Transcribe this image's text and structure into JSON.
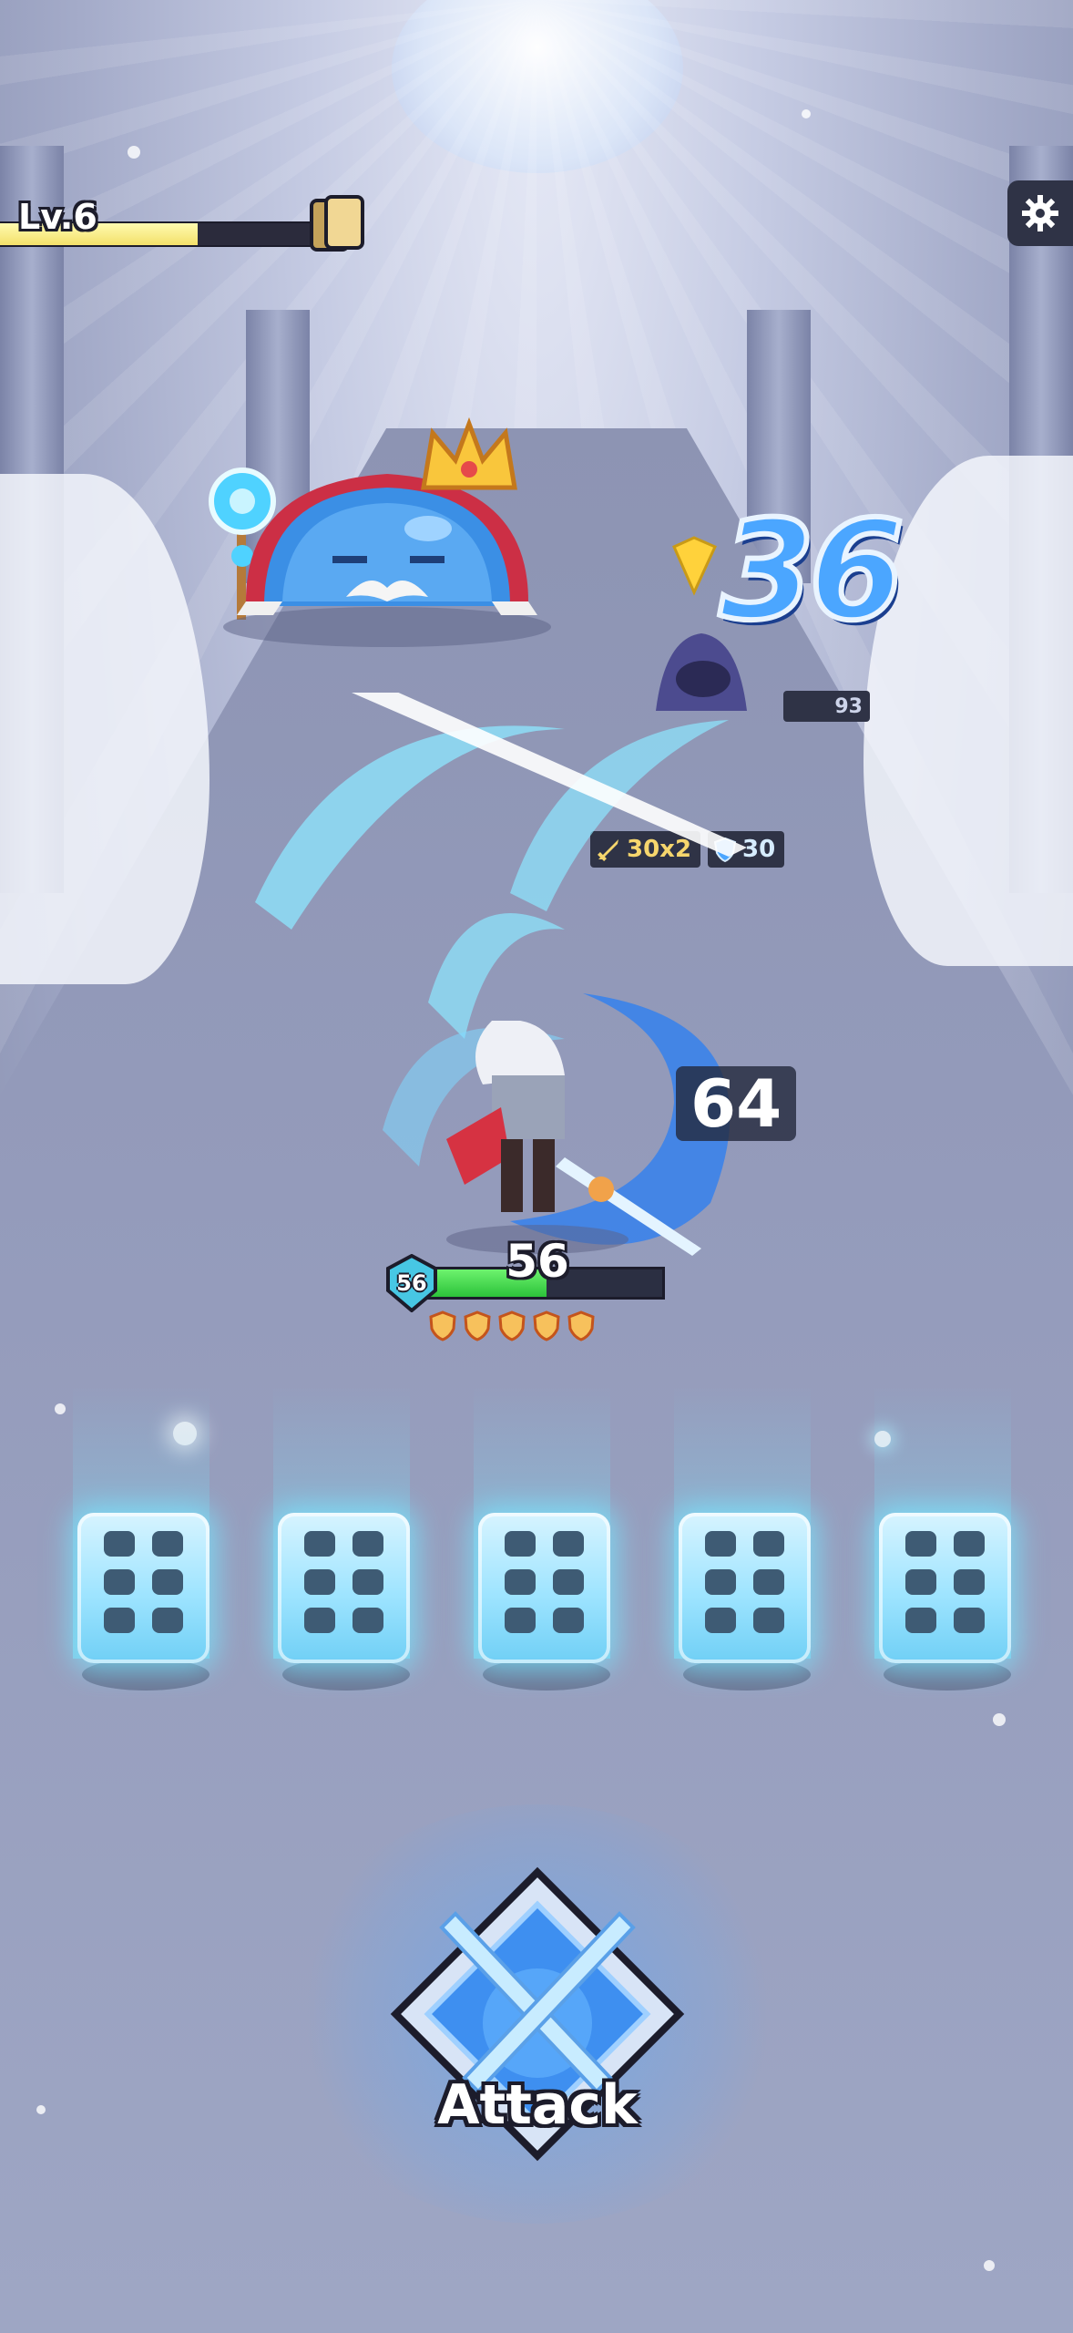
{
  "hud": {
    "level_label": "Lv.6",
    "xp_progress": 0.62,
    "cards_icon": "card-deck-icon",
    "settings_icon": "gear-icon"
  },
  "enemies": {
    "boss": {
      "name_icon": "slime-king",
      "crown_icon": "crown-icon"
    },
    "minion": {
      "hp_text": "93"
    },
    "intent": {
      "attack_text": "30x2",
      "defense_text": "30"
    }
  },
  "floating_damage": {
    "boss_hit": "36",
    "hero_hit": "64"
  },
  "hero": {
    "hp_text": "56",
    "hp_progress": 0.52,
    "shield_text": "56",
    "armor_pips": 5
  },
  "dice": [
    {
      "face": 6
    },
    {
      "face": 6
    },
    {
      "face": 6
    },
    {
      "face": 6
    },
    {
      "face": 6
    }
  ],
  "attack_button": {
    "label": "Attack",
    "icon": "crossed-swords-icon"
  },
  "colors": {
    "xp_fill": "#f3e06a",
    "hp_fill": "#2cc23a",
    "dice_glow": "#78e6ff",
    "damage_blue": "#4ba6ff"
  }
}
